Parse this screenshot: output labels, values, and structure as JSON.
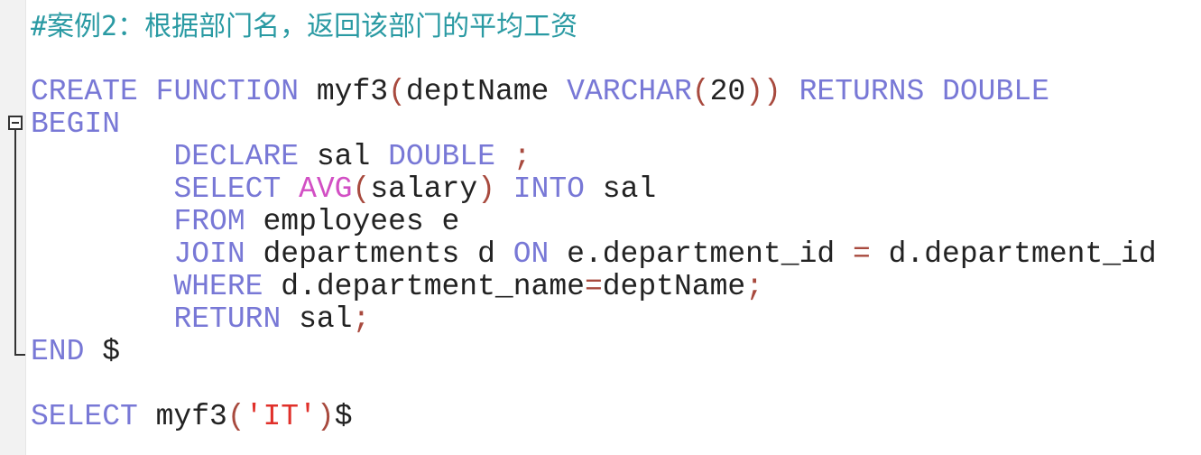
{
  "editor": {
    "language": "SQL",
    "colors": {
      "keyword": "#7878d6",
      "function": "#d24fc4",
      "punctuation": "#a84a3e",
      "string": "#e0302a",
      "comment": "#2a9aa3",
      "identifier": "#222222"
    },
    "lines": [
      [
        {
          "t": "#案例2：根据部门名，返回该部门的平均工资",
          "c": "cm"
        }
      ],
      [],
      [
        {
          "t": "CREATE",
          "c": "kw"
        },
        {
          "t": " ",
          "c": "id"
        },
        {
          "t": "FUNCTION",
          "c": "kw"
        },
        {
          "t": " myf3",
          "c": "id"
        },
        {
          "t": "(",
          "c": "pn"
        },
        {
          "t": "deptName ",
          "c": "id"
        },
        {
          "t": "VARCHAR",
          "c": "kw"
        },
        {
          "t": "(",
          "c": "pn"
        },
        {
          "t": "20",
          "c": "id"
        },
        {
          "t": "))",
          "c": "pn"
        },
        {
          "t": " ",
          "c": "id"
        },
        {
          "t": "RETURNS",
          "c": "kw"
        },
        {
          "t": " ",
          "c": "id"
        },
        {
          "t": "DOUBLE",
          "c": "kw"
        }
      ],
      [
        {
          "t": "BEGIN",
          "c": "kw"
        }
      ],
      [
        {
          "t": "        ",
          "c": "id"
        },
        {
          "t": "DECLARE",
          "c": "kw"
        },
        {
          "t": " sal ",
          "c": "id"
        },
        {
          "t": "DOUBLE",
          "c": "kw"
        },
        {
          "t": " ;",
          "c": "pn"
        }
      ],
      [
        {
          "t": "        ",
          "c": "id"
        },
        {
          "t": "SELECT",
          "c": "kw"
        },
        {
          "t": " ",
          "c": "id"
        },
        {
          "t": "AVG",
          "c": "fn"
        },
        {
          "t": "(",
          "c": "pn"
        },
        {
          "t": "salary",
          "c": "id"
        },
        {
          "t": ")",
          "c": "pn"
        },
        {
          "t": " ",
          "c": "id"
        },
        {
          "t": "INTO",
          "c": "kw"
        },
        {
          "t": " sal",
          "c": "id"
        }
      ],
      [
        {
          "t": "        ",
          "c": "id"
        },
        {
          "t": "FROM",
          "c": "kw"
        },
        {
          "t": " employees e",
          "c": "id"
        }
      ],
      [
        {
          "t": "        ",
          "c": "id"
        },
        {
          "t": "JOIN",
          "c": "kw"
        },
        {
          "t": " departments d ",
          "c": "id"
        },
        {
          "t": "ON",
          "c": "kw"
        },
        {
          "t": " e.department_id ",
          "c": "id"
        },
        {
          "t": "=",
          "c": "pn"
        },
        {
          "t": " d.department_id",
          "c": "id"
        }
      ],
      [
        {
          "t": "        ",
          "c": "id"
        },
        {
          "t": "WHERE",
          "c": "kw"
        },
        {
          "t": " d.department_name",
          "c": "id"
        },
        {
          "t": "=",
          "c": "pn"
        },
        {
          "t": "deptName",
          "c": "id"
        },
        {
          "t": ";",
          "c": "pn"
        }
      ],
      [
        {
          "t": "        ",
          "c": "id"
        },
        {
          "t": "RETURN",
          "c": "kw"
        },
        {
          "t": " sal",
          "c": "id"
        },
        {
          "t": ";",
          "c": "pn"
        }
      ],
      [
        {
          "t": "END",
          "c": "kw"
        },
        {
          "t": " $",
          "c": "id"
        }
      ],
      [],
      [
        {
          "t": "SELECT",
          "c": "kw"
        },
        {
          "t": " myf3",
          "c": "id"
        },
        {
          "t": "(",
          "c": "pn"
        },
        {
          "t": "'IT'",
          "c": "str"
        },
        {
          "t": ")",
          "c": "pn"
        },
        {
          "t": "$",
          "c": "id"
        }
      ]
    ]
  }
}
